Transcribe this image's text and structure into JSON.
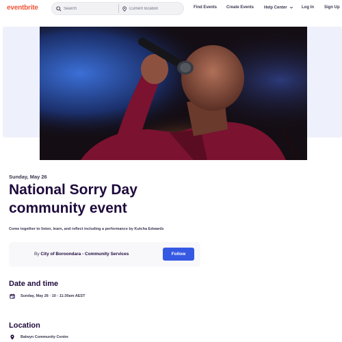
{
  "header": {
    "logo": "eventbrite",
    "search_placeholder": "Search",
    "location_placeholder": "Current location",
    "nav": [
      "Find Events",
      "Create Events",
      "Help Center",
      "Log In",
      "Sign Up"
    ]
  },
  "event": {
    "date_short": "Sunday, May 26",
    "title": "National Sorry Day community event",
    "summary": "Come together to listen, learn, and reflect including a performance by Kutcha Edwards",
    "organizer": {
      "prefix": "By",
      "name": "City of Boroondara - Community Services",
      "follow_label": "Follow"
    },
    "date_time": {
      "heading": "Date and time",
      "value": "Sunday, May 26 · 10 - 11:30am AEST"
    },
    "location": {
      "heading": "Location",
      "value": "Balwyn Community Centre"
    }
  },
  "colors": {
    "brand": "#f05537",
    "title": "#1e0a3c",
    "button": "#3659e3"
  }
}
